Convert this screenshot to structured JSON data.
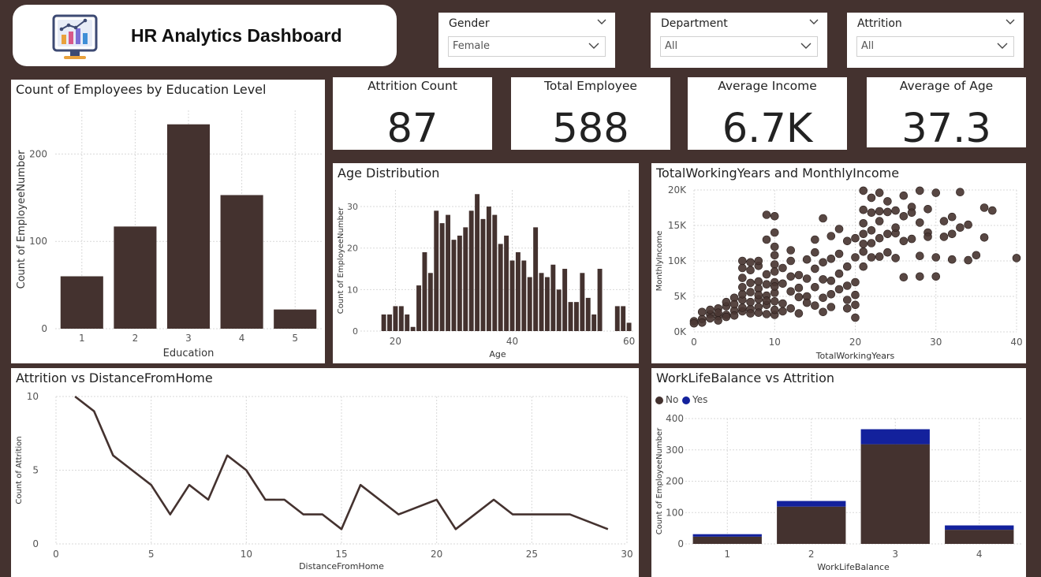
{
  "header": {
    "title": "HR Analytics Dashboard",
    "logo_icon": "analytics-monitor-icon"
  },
  "slicers": [
    {
      "label": "Gender",
      "value": "Female"
    },
    {
      "label": "Department",
      "value": "All"
    },
    {
      "label": "Attrition",
      "value": "All"
    }
  ],
  "kpis": [
    {
      "label": "Attrition Count",
      "value": "87"
    },
    {
      "label": "Total Employee",
      "value": "588"
    },
    {
      "label": "Average Income",
      "value": "6.7K"
    },
    {
      "label": "Average of Age",
      "value": "37.3"
    }
  ],
  "colors": {
    "background": "#44322f",
    "bar": "#44322f",
    "yes": "#13219c"
  },
  "chart_data": [
    {
      "id": "education",
      "type": "bar",
      "title": "Count of Employees by Education Level",
      "xlabel": "Education",
      "ylabel": "Count of EmployeeNumber",
      "categories": [
        "1",
        "2",
        "3",
        "4",
        "5"
      ],
      "values": [
        60,
        117,
        234,
        153,
        22
      ],
      "ylim": [
        0,
        250
      ],
      "yticks": [
        0,
        100,
        200
      ],
      "grid": true
    },
    {
      "id": "age",
      "type": "bar",
      "title": "Age Distribution",
      "xlabel": "Age",
      "ylabel": "Count of EmployeeNumber",
      "x": [
        18,
        19,
        20,
        21,
        22,
        23,
        24,
        25,
        26,
        27,
        28,
        29,
        30,
        31,
        32,
        33,
        34,
        35,
        36,
        37,
        38,
        39,
        40,
        41,
        42,
        43,
        44,
        45,
        46,
        47,
        48,
        49,
        50,
        51,
        52,
        53,
        54,
        55,
        56,
        57,
        58,
        59,
        60
      ],
      "values": [
        4,
        4,
        6,
        6,
        4,
        1,
        11,
        19,
        14,
        29,
        26,
        28,
        22,
        23,
        25,
        29,
        33,
        27,
        30,
        28,
        21,
        23,
        17,
        19,
        17,
        13,
        25,
        14,
        13,
        16,
        10,
        15,
        7,
        7,
        14,
        8,
        4,
        15,
        0,
        0,
        6,
        6,
        2
      ],
      "xlim": [
        14,
        61
      ],
      "xticks": [
        20,
        40,
        60
      ],
      "ylim": [
        0,
        34
      ],
      "yticks": [
        0,
        10,
        20,
        30
      ],
      "grid": true
    },
    {
      "id": "workyears-income",
      "type": "scatter",
      "title": "TotalWorkingYears and MonthlyIncome",
      "xlabel": "TotalWorkingYears",
      "ylabel": "MonthlyIncome",
      "xlim": [
        0,
        40
      ],
      "xticks": [
        0,
        10,
        20,
        30,
        40
      ],
      "ylim": [
        0,
        20000
      ],
      "yticks": [
        0,
        5000,
        10000,
        15000,
        20000
      ],
      "ytick_labels": [
        "0K",
        "5K",
        "10K",
        "15K",
        "20K"
      ],
      "grid": true,
      "points": [
        [
          0,
          1500
        ],
        [
          0,
          1200
        ],
        [
          1,
          1800
        ],
        [
          1,
          1300
        ],
        [
          1,
          2800
        ],
        [
          2,
          2500
        ],
        [
          2,
          1900
        ],
        [
          2,
          3100
        ],
        [
          3,
          2200
        ],
        [
          3,
          3300
        ],
        [
          3,
          2700
        ],
        [
          3,
          1600
        ],
        [
          4,
          2400
        ],
        [
          4,
          3600
        ],
        [
          4,
          4200
        ],
        [
          4,
          2100
        ],
        [
          5,
          3000
        ],
        [
          5,
          4800
        ],
        [
          5,
          2300
        ],
        [
          5,
          3900
        ],
        [
          6,
          4500
        ],
        [
          6,
          2900
        ],
        [
          6,
          5300
        ],
        [
          6,
          6300
        ],
        [
          6,
          3400
        ],
        [
          6,
          7600
        ],
        [
          6,
          9000
        ],
        [
          6,
          10000
        ],
        [
          7,
          5600
        ],
        [
          7,
          3200
        ],
        [
          7,
          6900
        ],
        [
          7,
          4200
        ],
        [
          7,
          2600
        ],
        [
          7,
          8700
        ],
        [
          7,
          9800
        ],
        [
          8,
          4600
        ],
        [
          8,
          6100
        ],
        [
          8,
          3500
        ],
        [
          8,
          7100
        ],
        [
          8,
          5200
        ],
        [
          8,
          2700
        ],
        [
          8,
          9300
        ],
        [
          8,
          10000
        ],
        [
          9,
          5100
        ],
        [
          9,
          6700
        ],
        [
          9,
          3800
        ],
        [
          9,
          8100
        ],
        [
          9,
          2500
        ],
        [
          9,
          4400
        ],
        [
          9,
          16500
        ],
        [
          9,
          13000
        ],
        [
          10,
          5500
        ],
        [
          10,
          7000
        ],
        [
          10,
          2400
        ],
        [
          10,
          9500
        ],
        [
          10,
          12000
        ],
        [
          10,
          4300
        ],
        [
          10,
          3100
        ],
        [
          10,
          6400
        ],
        [
          10,
          8500
        ],
        [
          10,
          10800
        ],
        [
          10,
          14000
        ],
        [
          10,
          16300
        ],
        [
          11,
          4000
        ],
        [
          11,
          6800
        ],
        [
          11,
          2900
        ],
        [
          11,
          9000
        ],
        [
          12,
          5700
        ],
        [
          12,
          3300
        ],
        [
          12,
          7800
        ],
        [
          12,
          11500
        ],
        [
          12,
          10000
        ],
        [
          13,
          4900
        ],
        [
          13,
          8000
        ],
        [
          13,
          6200
        ],
        [
          13,
          2600
        ],
        [
          14,
          5000
        ],
        [
          14,
          7500
        ],
        [
          14,
          10200
        ],
        [
          14,
          4100
        ],
        [
          15,
          6300
        ],
        [
          15,
          3700
        ],
        [
          15,
          8900
        ],
        [
          15,
          11200
        ],
        [
          15,
          13000
        ],
        [
          16,
          4800
        ],
        [
          16,
          7400
        ],
        [
          16,
          9800
        ],
        [
          16,
          16000
        ],
        [
          16,
          2800
        ],
        [
          17,
          5300
        ],
        [
          17,
          10300
        ],
        [
          17,
          7200
        ],
        [
          17,
          13500
        ],
        [
          17,
          3500
        ],
        [
          18,
          6000
        ],
        [
          18,
          8200
        ],
        [
          18,
          11000
        ],
        [
          18,
          14500
        ],
        [
          19,
          4500
        ],
        [
          19,
          9200
        ],
        [
          19,
          6500
        ],
        [
          19,
          12800
        ],
        [
          19,
          3300
        ],
        [
          20,
          5200
        ],
        [
          20,
          2000
        ],
        [
          20,
          13200
        ],
        [
          20,
          10500
        ],
        [
          20,
          3800
        ],
        [
          20,
          7000
        ],
        [
          21,
          11300
        ],
        [
          21,
          13800
        ],
        [
          21,
          17200
        ],
        [
          21,
          19900
        ],
        [
          21,
          15300
        ],
        [
          21,
          9200
        ],
        [
          21,
          12400
        ],
        [
          22,
          10500
        ],
        [
          22,
          14300
        ],
        [
          22,
          16800
        ],
        [
          22,
          18900
        ],
        [
          22,
          12500
        ],
        [
          23,
          13200
        ],
        [
          23,
          17000
        ],
        [
          23,
          19600
        ],
        [
          23,
          10600
        ],
        [
          23,
          15600
        ],
        [
          24,
          11200
        ],
        [
          24,
          13800
        ],
        [
          24,
          16900
        ],
        [
          24,
          18400
        ],
        [
          25,
          10400
        ],
        [
          25,
          13900
        ],
        [
          25,
          17100
        ],
        [
          25,
          14700
        ],
        [
          26,
          12800
        ],
        [
          26,
          16300
        ],
        [
          26,
          19200
        ],
        [
          26,
          7700
        ],
        [
          27,
          13100
        ],
        [
          27,
          17600
        ],
        [
          27,
          16800
        ],
        [
          28,
          10700
        ],
        [
          28,
          15400
        ],
        [
          28,
          19900
        ],
        [
          28,
          7800
        ],
        [
          29,
          14000
        ],
        [
          29,
          17300
        ],
        [
          29,
          13400
        ],
        [
          30,
          10500
        ],
        [
          30,
          7800
        ],
        [
          30,
          19600
        ],
        [
          31,
          13400
        ],
        [
          31,
          15600
        ],
        [
          32,
          16200
        ],
        [
          32,
          13800
        ],
        [
          32,
          10200
        ],
        [
          33,
          14700
        ],
        [
          33,
          19700
        ],
        [
          34,
          10100
        ],
        [
          34,
          15100
        ],
        [
          35,
          10800
        ],
        [
          36,
          13300
        ],
        [
          36,
          17500
        ],
        [
          37,
          17100
        ],
        [
          40,
          10400
        ]
      ]
    },
    {
      "id": "distance",
      "type": "line",
      "title": "Attrition vs DistanceFromHome",
      "xlabel": "DistanceFromHome",
      "ylabel": "Count of Attrition",
      "x": [
        1,
        2,
        3,
        4,
        5,
        6,
        7,
        8,
        9,
        10,
        11,
        12,
        13,
        14,
        15,
        16,
        18,
        20,
        21,
        23,
        24,
        27,
        29
      ],
      "values": [
        10,
        9,
        6,
        5,
        4,
        2,
        4,
        3,
        6,
        5,
        3,
        3,
        2,
        2,
        1,
        4,
        2,
        3,
        1,
        3,
        2,
        2,
        1
      ],
      "xlim": [
        0,
        30
      ],
      "xticks": [
        0,
        5,
        10,
        15,
        20,
        25,
        30
      ],
      "ylim": [
        0,
        10
      ],
      "yticks": [
        0,
        5,
        10
      ],
      "grid": true
    },
    {
      "id": "worklife",
      "type": "bar",
      "stacked": true,
      "title": "WorkLifeBalance vs Attrition",
      "xlabel": "WorkLifeBalance",
      "ylabel": "Count of EmployeeNumber",
      "legend_placement": "top-left",
      "categories": [
        "1",
        "2",
        "3",
        "4"
      ],
      "series": [
        {
          "name": "No",
          "values": [
            23,
            119,
            318,
            45
          ]
        },
        {
          "name": "Yes",
          "values": [
            8,
            18,
            48,
            14
          ]
        }
      ],
      "ylim": [
        0,
        400
      ],
      "yticks": [
        0,
        100,
        200,
        300,
        400
      ],
      "grid": true
    }
  ]
}
